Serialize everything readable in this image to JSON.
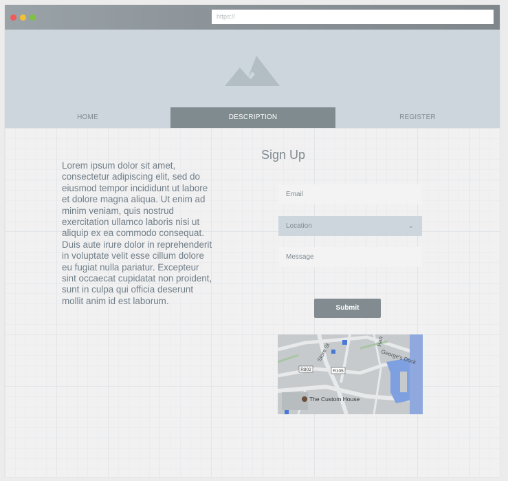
{
  "browser": {
    "url_text": "https://"
  },
  "nav": {
    "items": [
      {
        "label": "HOME"
      },
      {
        "label": "DESCRIPTION"
      },
      {
        "label": "REGISTER"
      }
    ]
  },
  "main": {
    "description": "Lorem ipsum dolor sit amet, consectetur adipiscing elit, sed do eiusmod tempor incididunt ut labore et dolore magna aliqua. Ut enim ad minim veniam, quis nostrud exercitation ullamco laboris nisi ut aliquip ex ea commodo consequat. Duis aute irure dolor in reprehenderit in voluptate velit esse cillum dolore eu fugiat nulla pariatur. Excepteur sint occaecat cupidatat non proident, sunt in culpa qui officia deserunt mollit anim id est laborum."
  },
  "form": {
    "title": "Sign Up",
    "email_placeholder": "Email",
    "location_placeholder": "Location",
    "message_placeholder": "Message",
    "submit_label": "Submit"
  },
  "map": {
    "labels": {
      "store_st": "Store St",
      "georges_dock": "George's Dock",
      "r802": "R802",
      "r105": "R105",
      "custom_house": "The Custom House",
      "han": "Han"
    }
  },
  "colors": {
    "accent": "#808b90",
    "hero_bg": "#cdd6dc",
    "text": "#6f7d86"
  }
}
